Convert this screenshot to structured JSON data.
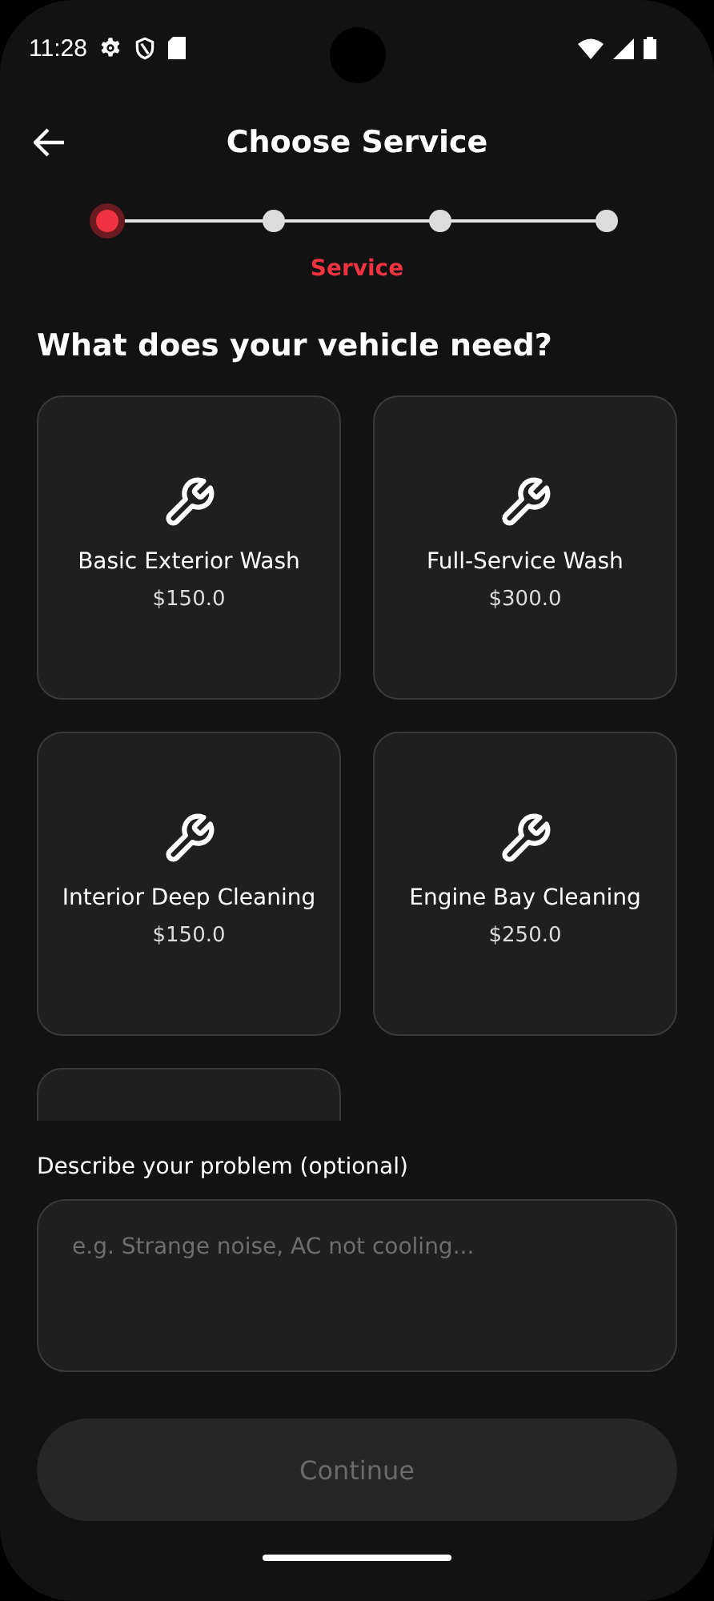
{
  "status_bar": {
    "time": "11:28"
  },
  "header": {
    "title": "Choose Service"
  },
  "stepper": {
    "current_label": "Service",
    "steps": [
      {
        "selected": true
      },
      {
        "selected": false
      },
      {
        "selected": false
      },
      {
        "selected": false
      }
    ]
  },
  "question": "What does your vehicle need?",
  "services": [
    {
      "kind": "service",
      "name": "Basic Exterior Wash",
      "price": "$150.0"
    },
    {
      "kind": "service",
      "name": "Full-Service Wash",
      "price": "$300.0"
    },
    {
      "kind": "service",
      "name": "Interior Deep Cleaning",
      "price": "$150.0"
    },
    {
      "kind": "service",
      "name": "Engine Bay Cleaning",
      "price": "$250.0"
    },
    {
      "kind": "partial"
    }
  ],
  "problem": {
    "label": "Describe your problem (optional)",
    "placeholder": "e.g. Strange noise, AC not cooling..."
  },
  "continue_button": {
    "label": "Continue",
    "disabled": true
  }
}
